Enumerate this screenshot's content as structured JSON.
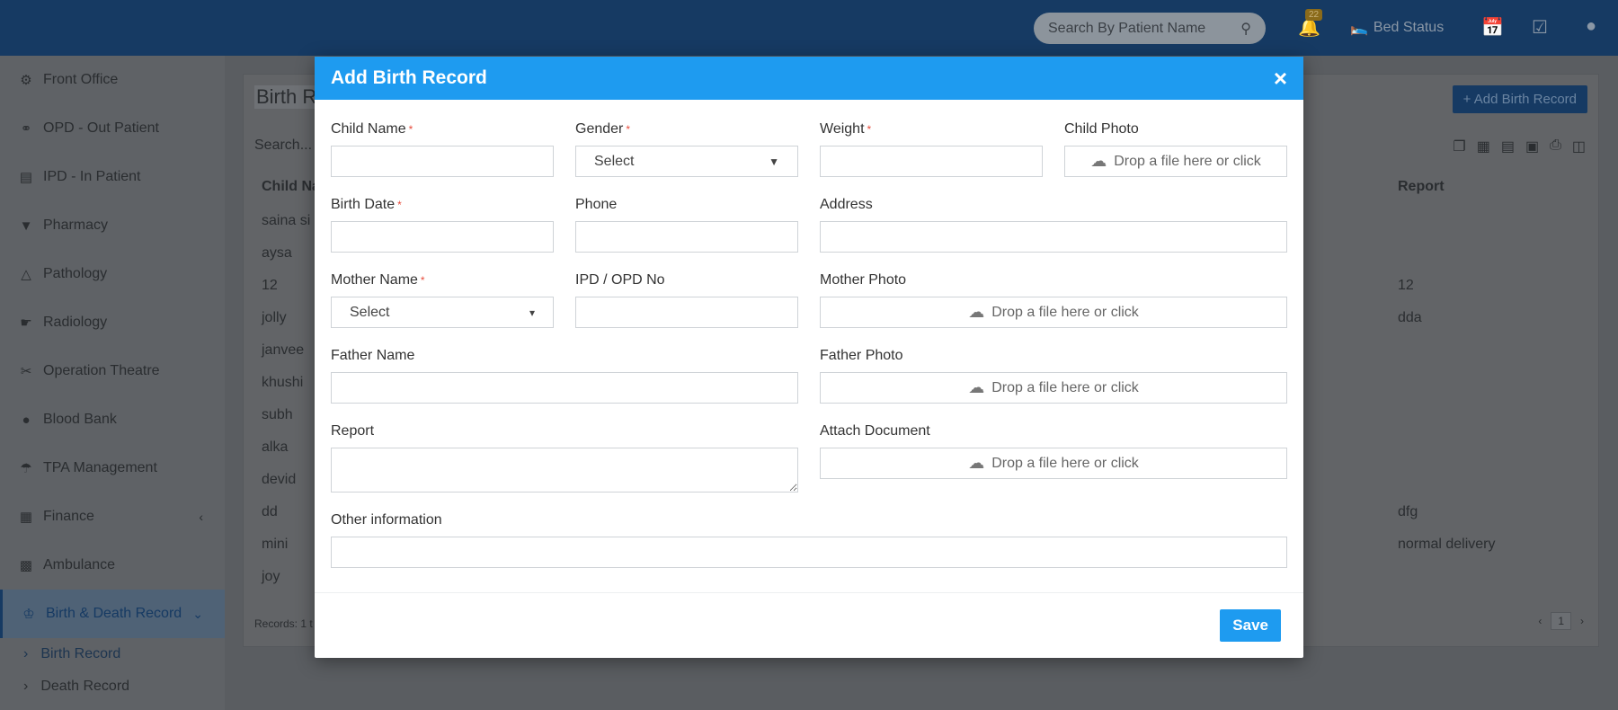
{
  "topbar": {
    "search_placeholder": "Search By Patient Name",
    "notification_count": "22",
    "bed_status_label": "Bed Status"
  },
  "sidebar": {
    "items": [
      {
        "label": "Front Office",
        "icon": "front-office-icon"
      },
      {
        "label": "OPD - Out Patient",
        "icon": "stethoscope-icon"
      },
      {
        "label": "IPD - In Patient",
        "icon": "bed-icon"
      },
      {
        "label": "Pharmacy",
        "icon": "mortar-pestle-icon"
      },
      {
        "label": "Pathology",
        "icon": "flask-icon"
      },
      {
        "label": "Radiology",
        "icon": "microscope-icon"
      },
      {
        "label": "Operation Theatre",
        "icon": "scissors-icon"
      },
      {
        "label": "Blood Bank",
        "icon": "drop-icon"
      },
      {
        "label": "TPA Management",
        "icon": "umbrella-icon"
      },
      {
        "label": "Finance",
        "icon": "money-icon"
      },
      {
        "label": "Ambulance",
        "icon": "ambulance-icon"
      },
      {
        "label": "Birth & Death Record",
        "icon": "family-icon"
      }
    ],
    "sub_items": [
      "Birth Record",
      "Death Record"
    ]
  },
  "background": {
    "title": "Birth R",
    "add_button": "+ Add Birth Record",
    "search_placeholder": "Search...",
    "col_child": "Child Na",
    "col_report": "Report",
    "rows": [
      {
        "child": "saina si",
        "report": ""
      },
      {
        "child": "aysa",
        "report": ""
      },
      {
        "child": "12",
        "report": "12"
      },
      {
        "child": "jolly",
        "report": "dda"
      },
      {
        "child": "janvee",
        "report": ""
      },
      {
        "child": "khushi",
        "report": ""
      },
      {
        "child": "subh",
        "report": ""
      },
      {
        "child": "alka",
        "report": ""
      },
      {
        "child": "devid",
        "report": ""
      },
      {
        "child": "dd",
        "report": "dfg"
      },
      {
        "child": "mini",
        "report": "normal delivery"
      },
      {
        "child": "joy",
        "report": ""
      }
    ],
    "records_text": "Records: 1 t",
    "page": "1"
  },
  "modal": {
    "title": "Add Birth Record",
    "close": "×",
    "child_name": "Child Name",
    "gender": "Gender",
    "gender_value": "Select",
    "weight": "Weight",
    "child_photo": "Child Photo",
    "drop_text": "Drop a file here or click",
    "birth_date": "Birth Date",
    "phone": "Phone",
    "address": "Address",
    "mother_name": "Mother Name",
    "mother_value": "Select",
    "ipd_opd": "IPD / OPD No",
    "mother_photo": "Mother Photo",
    "father_name": "Father Name",
    "father_photo": "Father Photo",
    "report": "Report",
    "attach_document": "Attach Document",
    "other_info": "Other information",
    "save": "Save"
  }
}
